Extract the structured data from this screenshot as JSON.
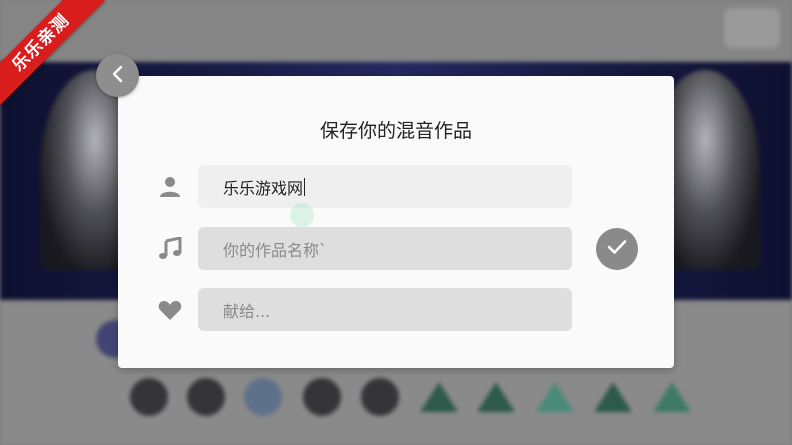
{
  "watermark": {
    "text": "乐乐亲测"
  },
  "dialog": {
    "title": "保存你的混音作品",
    "author_field": {
      "value": "乐乐游戏网",
      "icon": "person-icon"
    },
    "name_field": {
      "placeholder": "你的作品名称`",
      "icon": "music-note-icon"
    },
    "dedication_field": {
      "placeholder": "献给...",
      "icon": "heart-icon"
    },
    "confirm_icon": "checkmark-icon"
  },
  "navigation": {
    "back_icon": "chevron-left-icon"
  },
  "colors": {
    "dialog_bg": "#fafafa",
    "field_bg": "#dedede",
    "icon_gray": "#8a8a8a",
    "watermark_red": "#d91c1c"
  }
}
